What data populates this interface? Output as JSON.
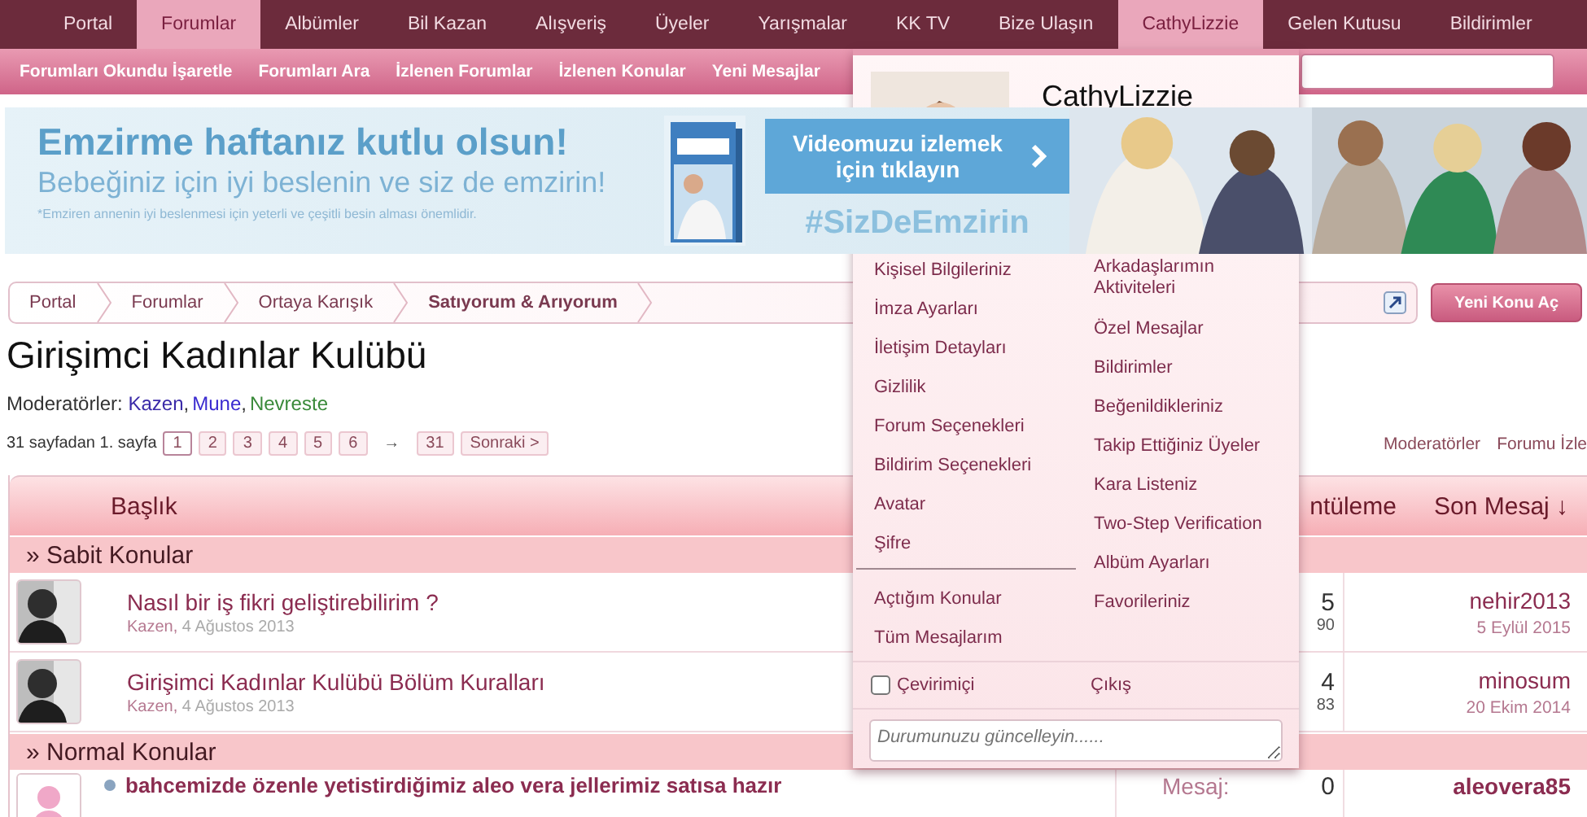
{
  "top_nav": {
    "left": [
      {
        "label": "Portal",
        "selected": false
      },
      {
        "label": "Forumlar",
        "selected": true
      },
      {
        "label": "Albümler",
        "selected": false
      },
      {
        "label": "Bil Kazan",
        "selected": false
      },
      {
        "label": "Alışveriş",
        "selected": false
      },
      {
        "label": "Üyeler",
        "selected": false
      },
      {
        "label": "Yarışmalar",
        "selected": false
      },
      {
        "label": "KK TV",
        "selected": false
      },
      {
        "label": "Bize Ulaşın",
        "selected": false
      }
    ],
    "right": [
      {
        "label": "CathyLizzie",
        "selected": true
      },
      {
        "label": "Gelen Kutusu",
        "selected": false
      },
      {
        "label": "Bildirimler",
        "selected": false
      }
    ]
  },
  "sub_nav": [
    "Forumları Okundu İşaretle",
    "Forumları Ara",
    "İzlenen Forumlar",
    "İzlenen Konular",
    "Yeni Mesajlar"
  ],
  "banner": {
    "headline": "Emzirme haftanız kutlu olsun!",
    "subline": "Bebeğiniz için iyi beslenin ve siz de emzirin!",
    "note": "*Emziren annenin iyi beslenmesi için yeterli ve çeşitli besin alması önemlidir.",
    "cta": "Videomuzu izlemek için tıklayın",
    "hashtag": "#SizDeEmzirin"
  },
  "user_menu": {
    "username": "CathyLizzie",
    "left_links": [
      "Kişisel Bilgileriniz",
      "İmza Ayarları",
      "İletişim Detayları",
      "Gizlilik",
      "Forum Seçenekleri",
      "Bildirim Seçenekleri",
      "Avatar",
      "Şifre"
    ],
    "left_links_2": [
      "Açtığım Konular",
      "Tüm Mesajlarım"
    ],
    "right_links": [
      "Arkadaşlarımın Aktiviteleri",
      "Özel Mesajlar",
      "Bildirimler",
      "Beğenildikleriniz",
      "Takip Ettiğiniz Üyeler",
      "Kara Listeniz",
      "Two-Step Verification",
      "Albüm Ayarları",
      "Favorileriniz"
    ],
    "online": {
      "label": "Çevirimiçi",
      "checked": false
    },
    "logout": "Çıkış",
    "status": {
      "placeholder": "Durumunuzu güncelleyin......"
    }
  },
  "breadcrumb": [
    "Portal",
    "Forumlar",
    "Ortaya Karışık",
    "Satıyorum & Arıyorum"
  ],
  "new_thread_button": "Yeni Konu Aç",
  "forum": {
    "title": "Girişimci Kadınlar Kulübü",
    "moderators_label": "Moderatörler:",
    "moderators": [
      {
        "name": "Kazen",
        "color": "#3a2aa8"
      },
      {
        "name": "Mune",
        "color": "#3a2ad0"
      },
      {
        "name": "Nevreste",
        "color": "#3a8a3a"
      }
    ],
    "separator": ","
  },
  "pagination": {
    "summary": "31 sayfadan 1. sayfa",
    "pages": [
      {
        "label": "1",
        "selected": true
      },
      {
        "label": "2",
        "selected": false
      },
      {
        "label": "3",
        "selected": false
      },
      {
        "label": "4",
        "selected": false
      },
      {
        "label": "5",
        "selected": false
      },
      {
        "label": "6",
        "selected": false
      }
    ],
    "arrow": "→",
    "last": "31",
    "next": "Sonraki >"
  },
  "forum_tools": [
    "Moderatörler",
    "Forumu İzle"
  ],
  "table": {
    "columns": [
      "Başlık",
      "ntüleme",
      "Son Mesaj ↓"
    ],
    "sections": [
      {
        "title": "» Sabit Konular",
        "threads": [
          {
            "title": "Nasıl bir iş fikri geliştirebilirim ?",
            "author": "Kazen,",
            "date": "4 Ağustos 2013",
            "unread": false,
            "replies": "5",
            "views": "90",
            "last_user": "nehir2013",
            "last_date": "5 Eylül 2015"
          },
          {
            "title": "Girişimci Kadınlar Kulübü Bölüm Kuralları",
            "author": "Kazen,",
            "date": "4 Ağustos 2013",
            "unread": false,
            "replies": "4",
            "views": "83",
            "last_user": "minosum",
            "last_date": "20 Ekim 2014"
          }
        ]
      },
      {
        "title": "» Normal Konular",
        "threads": [
          {
            "title": "bahcemizde özenle yetistirdiğimiz aleo vera jellerimiz satısa hazır",
            "unread": true,
            "stat_label": "Mesaj:",
            "replies": "0",
            "last_user": "aleovera85"
          }
        ]
      }
    ]
  }
}
